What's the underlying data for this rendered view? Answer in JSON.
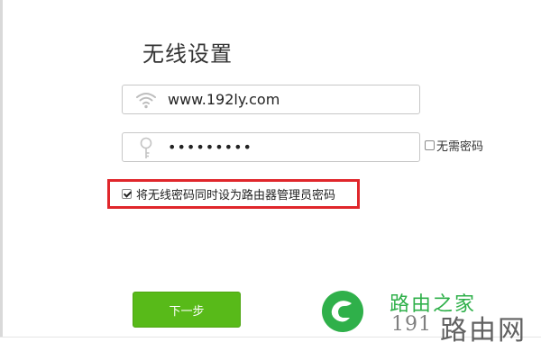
{
  "page": {
    "title": "无线设置"
  },
  "wifi": {
    "ssid_icon": "wifi-icon",
    "ssid_value": "www.192ly.com",
    "password_icon": "key-icon",
    "password_value": "•••••••••",
    "no_password_checked": false,
    "no_password_label": "无需密码",
    "sync_admin_checked": true,
    "sync_admin_label": "将无线密码同时设为路由器管理员密码"
  },
  "actions": {
    "next_label": "下一步"
  },
  "watermark": {
    "brand_cn": "路由之家",
    "domain_prefix": "191",
    "domain_cn": "路由网",
    "accent_color": "#2fb04a",
    "highlight_color": "#e0262b",
    "button_color": "#58ba19"
  }
}
